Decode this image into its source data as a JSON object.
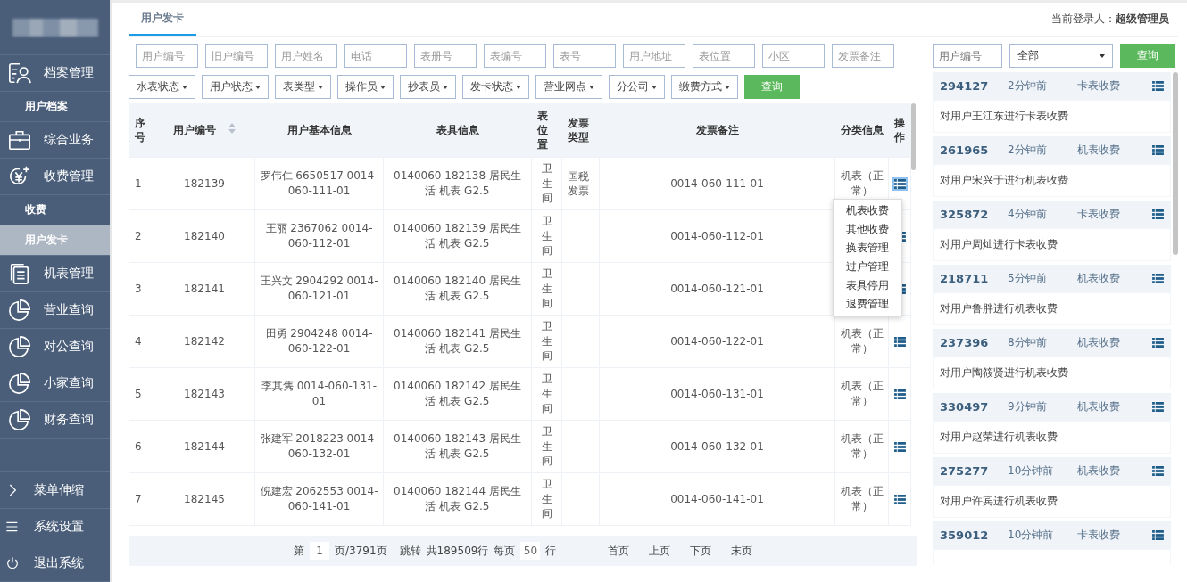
{
  "sidebar": {
    "items": [
      {
        "kind": "section",
        "label": "档案管理"
      },
      {
        "kind": "sub",
        "label": "用户档案",
        "selected": false
      },
      {
        "kind": "section",
        "label": "综合业务"
      },
      {
        "kind": "section",
        "label": "收费管理"
      },
      {
        "kind": "sub",
        "label": "收费",
        "selected": false
      },
      {
        "kind": "sub",
        "label": "用户发卡",
        "selected": true
      },
      {
        "kind": "section",
        "label": "机表管理"
      },
      {
        "kind": "section",
        "label": "营业查询"
      },
      {
        "kind": "section",
        "label": "对公查询"
      },
      {
        "kind": "section",
        "label": "小家查询"
      },
      {
        "kind": "section",
        "label": "财务查询"
      }
    ],
    "bottom": [
      {
        "label": "菜单伸缩"
      },
      {
        "label": "系统设置"
      },
      {
        "label": "退出系统"
      }
    ]
  },
  "tabs": [
    {
      "label": "用户发卡",
      "selected": true
    }
  ],
  "login": "当前登录人：**超级管理员**",
  "filters": {
    "fields": [
      {
        "placeholder": "用户编号"
      },
      {
        "placeholder": "旧户编号"
      },
      {
        "placeholder": "用户姓名"
      },
      {
        "placeholder": "电话"
      },
      {
        "placeholder": "表册号"
      },
      {
        "placeholder": "表编号"
      },
      {
        "placeholder": "表号"
      },
      {
        "placeholder": "用户地址"
      },
      {
        "placeholder": "表位置"
      },
      {
        "placeholder": "小区"
      },
      {
        "placeholder": "发票备注"
      }
    ],
    "dropdowns": [
      "水表状态",
      "用户状态",
      "表类型",
      "操作员",
      "抄表员",
      "发卡状态",
      "营业网点",
      "分公司",
      "缴费方式"
    ],
    "button": "查询"
  },
  "table": {
    "columns": [
      "序号",
      "用户编号",
      "用户基本信息",
      "表具信息",
      "表位置",
      "发票类型",
      "发票备注",
      "分类信息",
      "操作"
    ],
    "rows": [
      {
        "no": "1",
        "id": "182139",
        "info": "罗伟仁  6650517  0014-060-111-01",
        "meter": "0140060  182138  居民生活  机表    G2.5",
        "location": "卫生间",
        "invoice_type": "国税发票",
        "invoice_note": "0014-060-111-01",
        "category": "机表（正常）",
        "menu_open": true
      },
      {
        "no": "2",
        "id": "182140",
        "info": "王丽  2367062  0014-060-112-01",
        "meter": "0140060  182139  居民生活  机表    G2.5",
        "location": "卫生间",
        "invoice_note": "0014-060-112-01",
        "menu_open": false
      },
      {
        "no": "3",
        "id": "182141",
        "info": "王兴文  2904292  0014-060-121-01",
        "meter": "0140060  182140  居民生活  机表    G2.5",
        "location": "卫生间",
        "invoice_note": "0014-060-121-01",
        "menu_open": false
      },
      {
        "no": "4",
        "id": "182142",
        "info": "田勇  2904248  0014-060-122-01",
        "meter": "0140060  182141  居民生活  机表    G2.5",
        "location": "卫生间",
        "invoice_note": "0014-060-122-01",
        "category": "机表（正常）",
        "menu_open": false
      },
      {
        "no": "5",
        "id": "182143",
        "info": "李其隽    0014-060-131-01",
        "meter": "0140060  182142  居民生活  机表    G2.5",
        "location": "卫生间",
        "invoice_note": "0014-060-131-01",
        "category": "机表（正常）",
        "menu_open": false
      },
      {
        "no": "6",
        "id": "182144",
        "info": "张建军  2018223  0014-060-132-01",
        "meter": "0140060  182143  居民生活  机表    G2.5",
        "location": "卫生间",
        "invoice_note": "0014-060-132-01",
        "category": "机表（正常）",
        "menu_open": false
      },
      {
        "no": "7",
        "id": "182145",
        "info": "倪建宏  2062553  0014-060-141-01",
        "meter": "0140060  182144  居民生活  机表    G2.5",
        "location": "卫生间",
        "invoice_note": "0014-060-141-01",
        "category": "机表（正常）",
        "menu_open": false
      }
    ]
  },
  "action_menu": [
    "机表收费",
    "其他收费",
    "换表管理",
    "过户管理",
    "表具停用",
    "退费管理"
  ],
  "pagination": {
    "page_prefix": "第",
    "page": "1",
    "page_suffix": "页/3791页",
    "jump": "跳转",
    "total": "共189509行",
    "per_page_prefix": "每页",
    "per_page": "50",
    "per_page_suffix": "行",
    "links": [
      "首页",
      "上页",
      "下页",
      "末页"
    ]
  },
  "activity": {
    "search_placeholder": "用户编号",
    "select": "全部",
    "button": "查询",
    "entries": [
      {
        "id": "294127",
        "time": "2分钟前",
        "type": "卡表收费",
        "text": "对用户王江东进行卡表收费"
      },
      {
        "id": "261965",
        "time": "2分钟前",
        "type": "机表收费",
        "text": "对用户宋兴于进行机表收费"
      },
      {
        "id": "325872",
        "time": "4分钟前",
        "type": "卡表收费",
        "text": "对用户周灿进行卡表收费"
      },
      {
        "id": "218711",
        "time": "5分钟前",
        "type": "机表收费",
        "text": "对用户鲁胖进行机表收费"
      },
      {
        "id": "237396",
        "time": "8分钟前",
        "type": "机表收费",
        "text": "对用户陶筱贤进行机表收费"
      },
      {
        "id": "330497",
        "time": "9分钟前",
        "type": "机表收费",
        "text": "对用户赵荣进行机表收费"
      },
      {
        "id": "275277",
        "time": "10分钟前",
        "type": "机表收费",
        "text": "对用户许宾进行机表收费"
      },
      {
        "id": "359012",
        "time": "10分钟前",
        "type": "卡表收费"
      }
    ]
  }
}
